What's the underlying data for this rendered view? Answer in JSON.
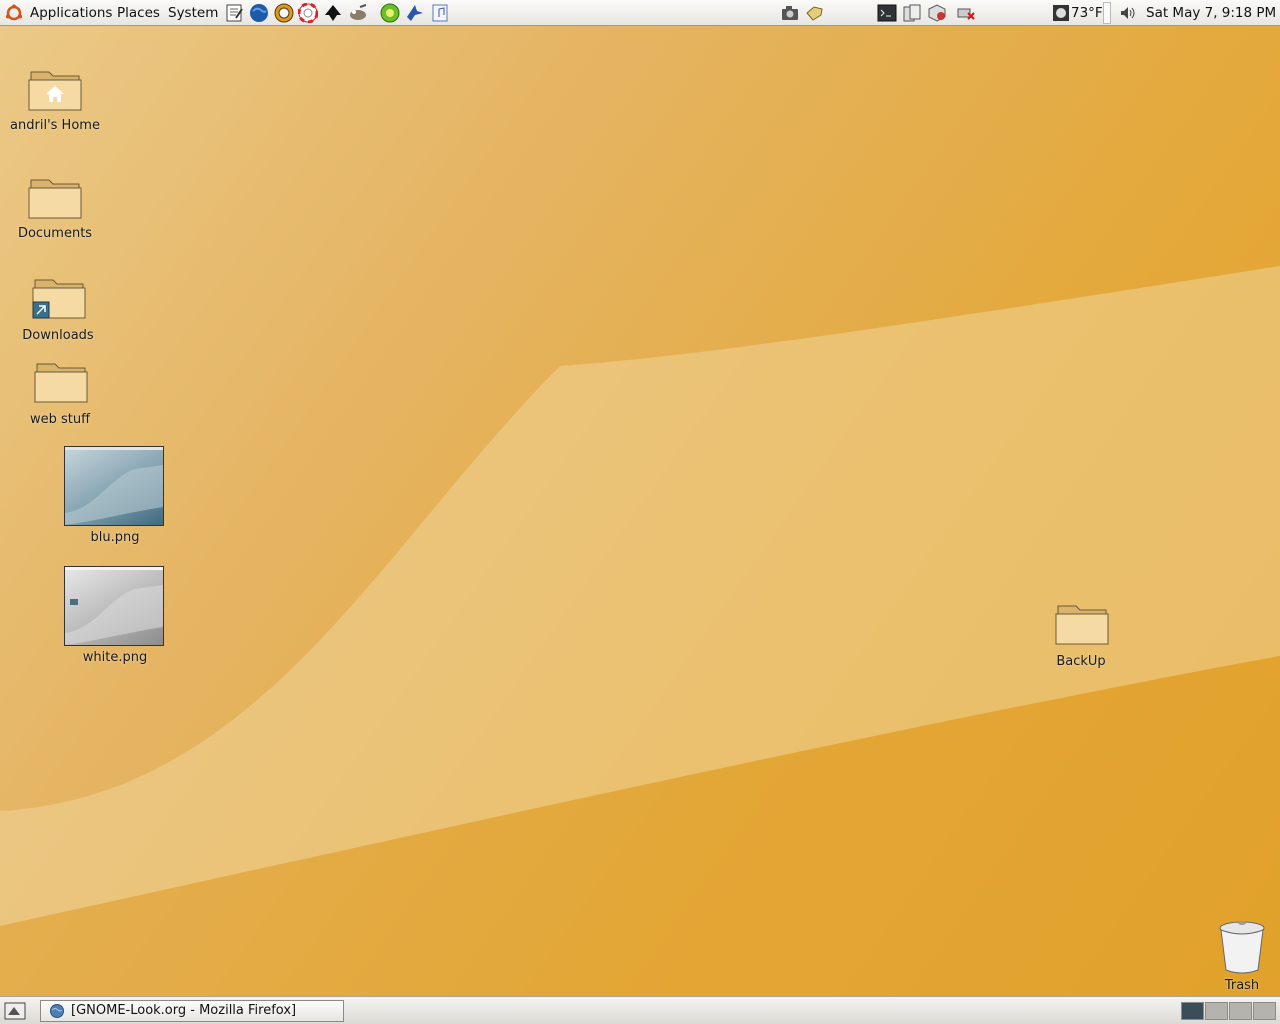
{
  "top_panel": {
    "menus": [
      "Applications",
      "Places",
      "System"
    ],
    "weather": "73°F",
    "clock": "Sat May  7,  9:18 PM"
  },
  "desktop": {
    "icons": [
      {
        "label": "andril's Home"
      },
      {
        "label": "Documents"
      },
      {
        "label": "Downloads"
      },
      {
        "label": "web stuff"
      },
      {
        "label": "blu.png"
      },
      {
        "label": "white.png"
      },
      {
        "label": "BackUp"
      },
      {
        "label": "Trash"
      }
    ]
  },
  "bottom_panel": {
    "task": "[GNOME-Look.org - Mozilla Firefox]",
    "workspaces": [
      "workspace-1",
      "workspace-2",
      "workspace-3",
      "workspace-4"
    ]
  },
  "colors": {
    "accent_orange": "#e4a93c",
    "folder_tan": "#f3d79c"
  }
}
